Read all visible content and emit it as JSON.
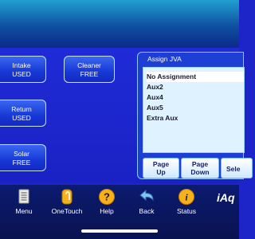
{
  "tiles": {
    "intake": {
      "label": "Intake",
      "status": "USED"
    },
    "cleaner": {
      "label": "Cleaner",
      "status": "FREE"
    },
    "return": {
      "label": "Return",
      "status": "USED"
    },
    "solar": {
      "label": "Solar",
      "status": "FREE"
    }
  },
  "assign_jva": {
    "title": "Assign JVA",
    "items": [
      "No Assignment",
      "Aux2",
      "Aux4",
      "Aux5",
      "Extra Aux"
    ],
    "selected": "No Assignment",
    "buttons": {
      "page_up": [
        "Page",
        "Up"
      ],
      "page_down": [
        "Page",
        "Down"
      ],
      "select": "Sele"
    }
  },
  "nav": {
    "menu": "Menu",
    "onetouch": "OneTouch",
    "help": "Help",
    "back": "Back",
    "status": "Status"
  },
  "brand": "iAq",
  "colors": {
    "background": "#1d24c8",
    "tile_border": "#c9e4ff",
    "list_background": "#dff2ff",
    "nav_background": "#0b1b70"
  },
  "icons": [
    "menu-icon",
    "onetouch-icon",
    "help-icon",
    "back-icon",
    "status-icon"
  ]
}
